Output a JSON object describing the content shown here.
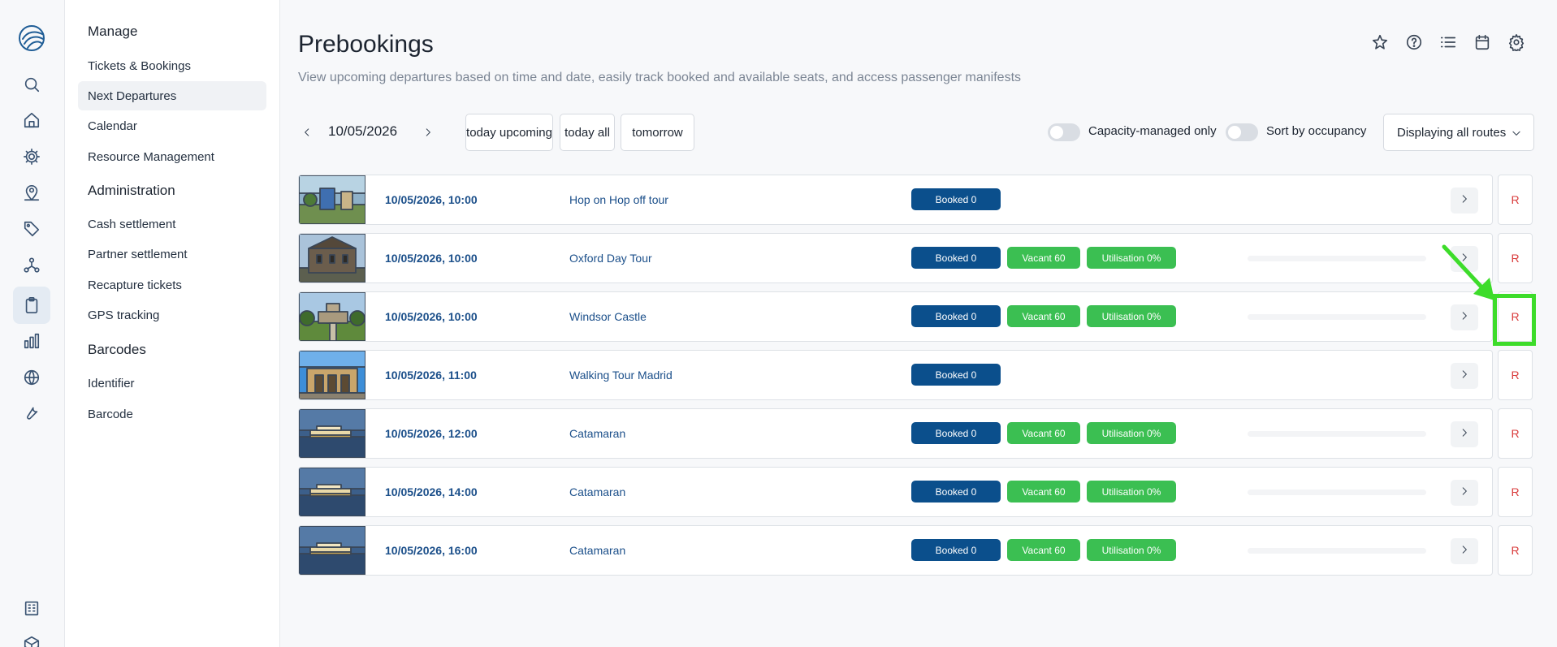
{
  "rail": {
    "icons": [
      "logo-icon",
      "search-icon",
      "home-icon",
      "gear-icon",
      "location-user-icon",
      "tag-icon",
      "network-icon",
      "clipboard-icon",
      "bar-chart-icon",
      "globe-icon",
      "wrench-icon",
      "building-icon",
      "box-icon"
    ],
    "active": "clipboard-icon"
  },
  "sidebar": {
    "sections": [
      {
        "title": "Manage",
        "items": [
          "Tickets & Bookings",
          "Next Departures",
          "Calendar",
          "Resource Management"
        ]
      },
      {
        "title": "Administration",
        "items": [
          "Cash settlement",
          "Partner settlement",
          "Recapture tickets",
          "GPS tracking"
        ]
      },
      {
        "title": "Barcodes",
        "items": [
          "Identifier",
          "Barcode"
        ]
      }
    ],
    "active_item": "Next Departures"
  },
  "page": {
    "title": "Prebookings",
    "subtitle": "View upcoming departures based on time and date, easily track booked and available seats, and access passenger manifests"
  },
  "top_icons": [
    "star-icon",
    "help-icon",
    "list-icon",
    "calendar-icon",
    "settings-icon"
  ],
  "toolbar": {
    "date": "10/05/2026",
    "quick_buttons": [
      "today upcoming",
      "today all",
      "tomorrow"
    ],
    "toggle_capacity": "Capacity-managed only",
    "toggle_sort": "Sort by occupancy",
    "routes_select": "Displaying all routes"
  },
  "rows": [
    {
      "datetime": "10/05/2026, 10:00",
      "route": "Hop on Hop off tour",
      "booked": "Booked 0",
      "vacant": "",
      "util": "",
      "bar": false,
      "thumb": "bus",
      "r": "R"
    },
    {
      "datetime": "10/05/2026, 10:00",
      "route": "Oxford Day Tour",
      "booked": "Booked 0",
      "vacant": "Vacant 60",
      "util": "Utilisation 0%",
      "bar": true,
      "thumb": "oxford",
      "r": "R"
    },
    {
      "datetime": "10/05/2026, 10:00",
      "route": "Windsor Castle",
      "booked": "Booked 0",
      "vacant": "Vacant 60",
      "util": "Utilisation 0%",
      "bar": true,
      "thumb": "windsor",
      "r": "R"
    },
    {
      "datetime": "10/05/2026, 11:00",
      "route": "Walking Tour Madrid",
      "booked": "Booked 0",
      "vacant": "",
      "util": "",
      "bar": false,
      "thumb": "madrid",
      "r": "R"
    },
    {
      "datetime": "10/05/2026, 12:00",
      "route": "Catamaran",
      "booked": "Booked 0",
      "vacant": "Vacant 60",
      "util": "Utilisation 0%",
      "bar": true,
      "thumb": "boat",
      "r": "R"
    },
    {
      "datetime": "10/05/2026, 14:00",
      "route": "Catamaran",
      "booked": "Booked 0",
      "vacant": "Vacant 60",
      "util": "Utilisation 0%",
      "bar": true,
      "thumb": "boat",
      "r": "R"
    },
    {
      "datetime": "10/05/2026, 16:00",
      "route": "Catamaran",
      "booked": "Booked 0",
      "vacant": "Vacant 60",
      "util": "Utilisation 0%",
      "bar": true,
      "thumb": "boat",
      "r": "R"
    }
  ],
  "colors": {
    "booked": "#0b4f8c",
    "vacant": "#3bbf52",
    "link": "#1b4f8a",
    "r_text": "#d93b3b",
    "annotation": "#3ddc2a"
  }
}
